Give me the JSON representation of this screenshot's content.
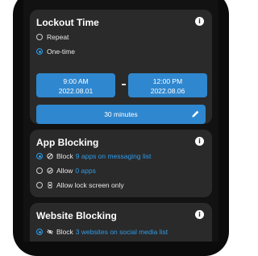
{
  "colors": {
    "accent": "#2f9be8",
    "button": "#2f87cf",
    "card": "#2a2a2a",
    "screen": "#121212"
  },
  "lockout": {
    "title": "Lockout Time",
    "options": [
      {
        "label": "Repeat",
        "selected": false
      },
      {
        "label": "One-time",
        "selected": true
      }
    ],
    "start": {
      "time": "9:00 AM",
      "date": "2022.08.01"
    },
    "end": {
      "time": "12:00 PM",
      "date": "2022.08.06"
    },
    "duration": "30 minutes"
  },
  "app_blocking": {
    "title": "App Blocking",
    "options": [
      {
        "selected": true,
        "icon": "block-icon",
        "prefix": "Block",
        "highlight": "9 apps on messaging list"
      },
      {
        "selected": false,
        "icon": "check-circle-icon",
        "prefix": "Allow",
        "highlight": "0 apps"
      },
      {
        "selected": false,
        "icon": "phone-lock-icon",
        "prefix": "Allow lock screen only",
        "highlight": ""
      }
    ]
  },
  "website_blocking": {
    "title": "Website Blocking",
    "options": [
      {
        "selected": true,
        "icon": "eye-off-icon",
        "prefix": "Block",
        "highlight": "3 websites on social media list"
      }
    ]
  }
}
